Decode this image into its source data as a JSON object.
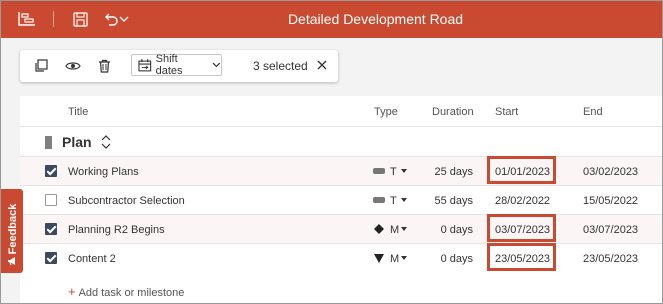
{
  "window": {
    "title": "Detailed Development Road"
  },
  "titlebar_icons": [
    "gantt-icon",
    "save-icon",
    "undo-icon",
    "chevron-down-icon"
  ],
  "toolbar": {
    "shift_label": "Shift dates",
    "selected_text": "3 selected"
  },
  "columns": {
    "title": "Title",
    "type": "Type",
    "duration": "Duration",
    "start": "Start",
    "end": "End"
  },
  "group": {
    "label": "Plan"
  },
  "rows": [
    {
      "checked": true,
      "title": "Working Plans",
      "type_icon": "task-bar-icon",
      "type": "T",
      "duration": "25 days",
      "start": "01/01/2023",
      "end": "03/02/2023",
      "highlight_start": true
    },
    {
      "checked": false,
      "title": "Subcontractor Selection",
      "type_icon": "task-bar-icon",
      "type": "T",
      "duration": "55 days",
      "start": "28/02/2022",
      "end": "15/05/2022",
      "highlight_start": false
    },
    {
      "checked": true,
      "title": "Planning R2 Begins",
      "type_icon": "milestone-diamond-icon",
      "type": "M",
      "duration": "0 days",
      "start": "03/07/2023",
      "end": "03/07/2023",
      "highlight_start": true
    },
    {
      "checked": true,
      "title": "Content 2",
      "type_icon": "milestone-triangle-icon",
      "type": "M",
      "duration": "0 days",
      "start": "23/05/2023",
      "end": "23/05/2023",
      "highlight_start": true
    }
  ],
  "add_row": {
    "label": "Add task or milestone"
  },
  "feedback": {
    "label": "Feedback"
  },
  "colors": {
    "accent": "#c94a31",
    "checkbox": "#3c4a5c",
    "row_alt": "#fbf6f5"
  }
}
